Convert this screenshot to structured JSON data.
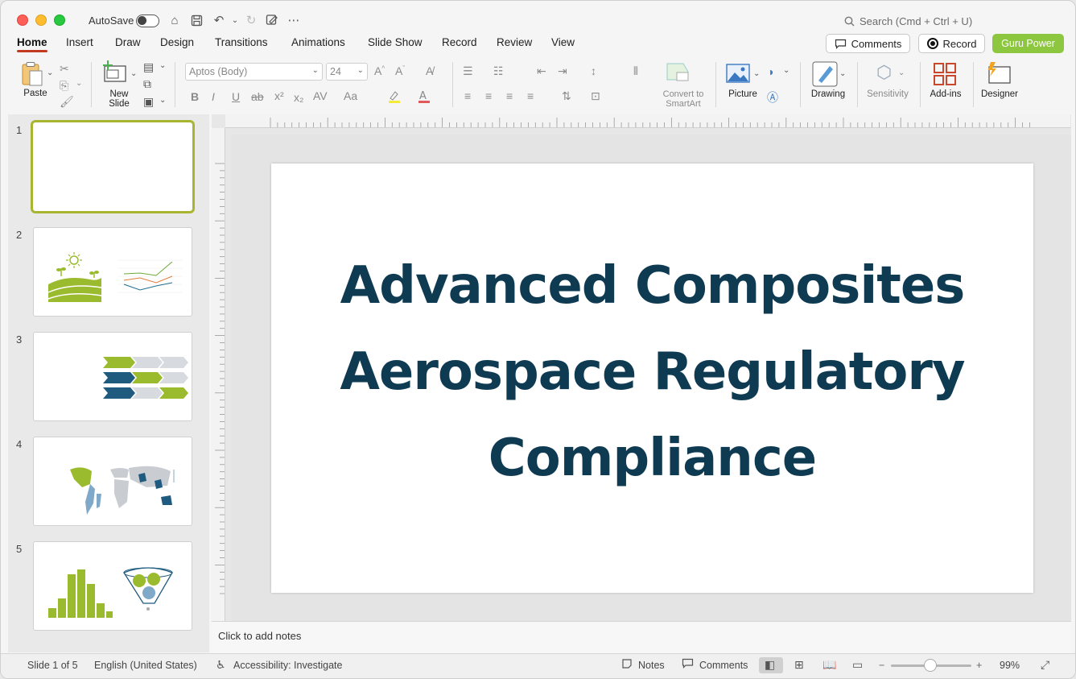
{
  "titlebar": {
    "autosave_label": "AutoSave",
    "search_placeholder": "Search (Cmd + Ctrl + U)"
  },
  "tabs": [
    {
      "label": "Home"
    },
    {
      "label": "Insert"
    },
    {
      "label": "Draw"
    },
    {
      "label": "Design"
    },
    {
      "label": "Transitions"
    },
    {
      "label": "Animations"
    },
    {
      "label": "Slide Show"
    },
    {
      "label": "Record"
    },
    {
      "label": "Review"
    },
    {
      "label": "View"
    }
  ],
  "actions": {
    "comments": "Comments",
    "record": "Record",
    "guru": "Guru Power"
  },
  "ribbon": {
    "paste": "Paste",
    "new_slide": "New Slide",
    "font_name": "Aptos (Body)",
    "font_size": "24",
    "convert_smartart": "Convert to SmartArt",
    "picture": "Picture",
    "drawing": "Drawing",
    "sensitivity": "Sensitivity",
    "addins": "Add-ins",
    "designer": "Designer"
  },
  "slides": [
    {
      "number": "1"
    },
    {
      "number": "2"
    },
    {
      "number": "3"
    },
    {
      "number": "4"
    },
    {
      "number": "5"
    }
  ],
  "slide": {
    "title_lines": [
      "Advanced Composites",
      "Aerospace Regulatory",
      "Compliance"
    ]
  },
  "notes": {
    "placeholder": "Click to add notes"
  },
  "status": {
    "slide_count": "Slide 1 of 5",
    "language": "English (United States)",
    "accessibility": "Accessibility: Investigate",
    "notes": "Notes",
    "comments": "Comments",
    "zoom": "99%"
  },
  "colors": {
    "accent": "#c23b21",
    "brand_green": "#8dc63f",
    "title_navy": "#0e3a52",
    "thumb_selected": "#a8b530"
  }
}
